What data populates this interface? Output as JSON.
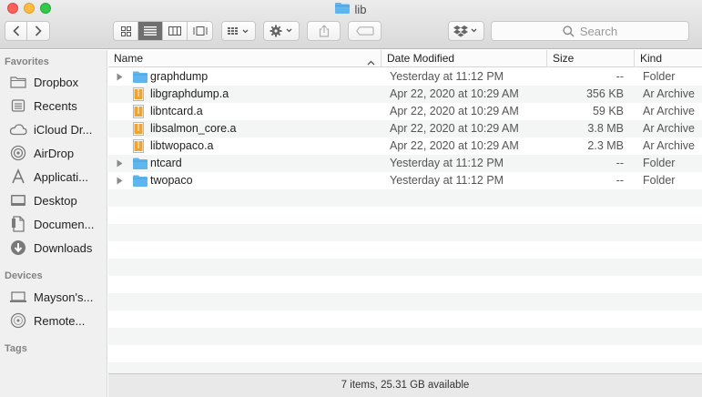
{
  "window": {
    "title": "lib"
  },
  "toolbar": {
    "view_buttons": [
      "icon-view",
      "list-view",
      "column-view",
      "gallery-view"
    ],
    "active_view": "list-view",
    "search": {
      "placeholder": "Search"
    }
  },
  "sidebar": {
    "favorites_heading": "Favorites",
    "favorites": [
      {
        "label": "Dropbox",
        "icon": "dropbox-folder-icon"
      },
      {
        "label": "Recents",
        "icon": "recents-icon"
      },
      {
        "label": "iCloud Dr...",
        "icon": "icloud-icon"
      },
      {
        "label": "AirDrop",
        "icon": "airdrop-icon"
      },
      {
        "label": "Applicati...",
        "icon": "applications-icon"
      },
      {
        "label": "Desktop",
        "icon": "desktop-icon"
      },
      {
        "label": "Documen...",
        "icon": "documents-icon"
      },
      {
        "label": "Downloads",
        "icon": "downloads-icon"
      }
    ],
    "devices_heading": "Devices",
    "devices": [
      {
        "label": "Mayson's...",
        "icon": "laptop-icon"
      },
      {
        "label": "Remote...",
        "icon": "remote-disc-icon"
      }
    ],
    "tags_heading": "Tags"
  },
  "columns": {
    "name": "Name",
    "date": "Date Modified",
    "size": "Size",
    "kind": "Kind"
  },
  "files": [
    {
      "name": "graphdump",
      "date": "Yesterday at 11:12 PM",
      "size": "--",
      "kind": "Folder",
      "type": "folder"
    },
    {
      "name": "libgraphdump.a",
      "date": "Apr 22, 2020 at 10:29 AM",
      "size": "356 KB",
      "kind": "Ar Archive",
      "type": "archive"
    },
    {
      "name": "libntcard.a",
      "date": "Apr 22, 2020 at 10:29 AM",
      "size": "59 KB",
      "kind": "Ar Archive",
      "type": "archive"
    },
    {
      "name": "libsalmon_core.a",
      "date": "Apr 22, 2020 at 10:29 AM",
      "size": "3.8 MB",
      "kind": "Ar Archive",
      "type": "archive"
    },
    {
      "name": "libtwopaco.a",
      "date": "Apr 22, 2020 at 10:29 AM",
      "size": "2.3 MB",
      "kind": "Ar Archive",
      "type": "archive"
    },
    {
      "name": "ntcard",
      "date": "Yesterday at 11:12 PM",
      "size": "--",
      "kind": "Folder",
      "type": "folder"
    },
    {
      "name": "twopaco",
      "date": "Yesterday at 11:12 PM",
      "size": "--",
      "kind": "Folder",
      "type": "folder"
    }
  ],
  "status": {
    "text": "7 items, 25.31 GB available"
  },
  "colors": {
    "folder": "#5fb6ef",
    "archive": "#f0a330",
    "selected_view": "#6f6f6f"
  }
}
